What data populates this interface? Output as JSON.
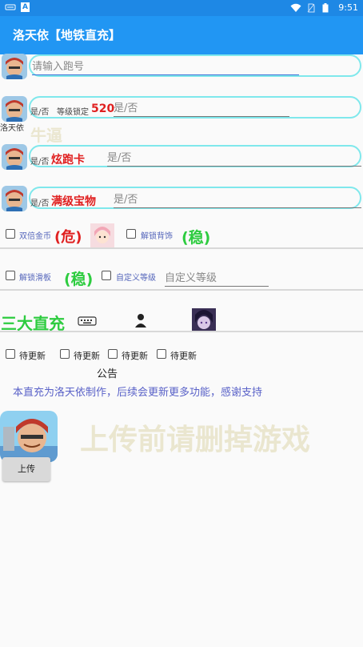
{
  "status_bar": {
    "time": "9:51",
    "notif_a": "A"
  },
  "appbar": {
    "title": "洛天依【地铁直充】"
  },
  "run_id": {
    "placeholder": "请输入跑号"
  },
  "level_row": {
    "yesno_prefix": "是/否",
    "label": "等级锁定",
    "value": "520",
    "input_placeholder": "是/否"
  },
  "author": {
    "name": "洛天依",
    "watermark": "牛逼"
  },
  "board_row": {
    "yesno_prefix": "是/否",
    "label": "炫跑卡",
    "input_placeholder": "是/否"
  },
  "treasure_row": {
    "yesno_prefix": "是/否",
    "label": "满级宝物",
    "input_placeholder": "是/否"
  },
  "options1": {
    "double_coins": "双倍金币",
    "danger": "(危)",
    "unlock_backpack": "解锁背饰",
    "stable": "(稳)"
  },
  "options2": {
    "unlock_board": "解锁滑板",
    "stable": "(稳)",
    "custom_level": "自定义等级",
    "custom_level_placeholder": "自定义等级"
  },
  "three_charge": {
    "title": "三大直充"
  },
  "pending": {
    "items": [
      "待更新",
      "待更新",
      "待更新",
      "待更新"
    ]
  },
  "notice": {
    "title": "公告",
    "text": "本直充为洛天依制作，后续会更新更多功能，感谢支持"
  },
  "upload": {
    "watermark": "上传前请删掉游戏",
    "button": "上传"
  },
  "colors": {
    "appbar": "#2196f3",
    "statusbar": "#1e88e5",
    "pill_border": "#7fe8ec",
    "red": "#e02020",
    "green": "#2ecc40"
  }
}
